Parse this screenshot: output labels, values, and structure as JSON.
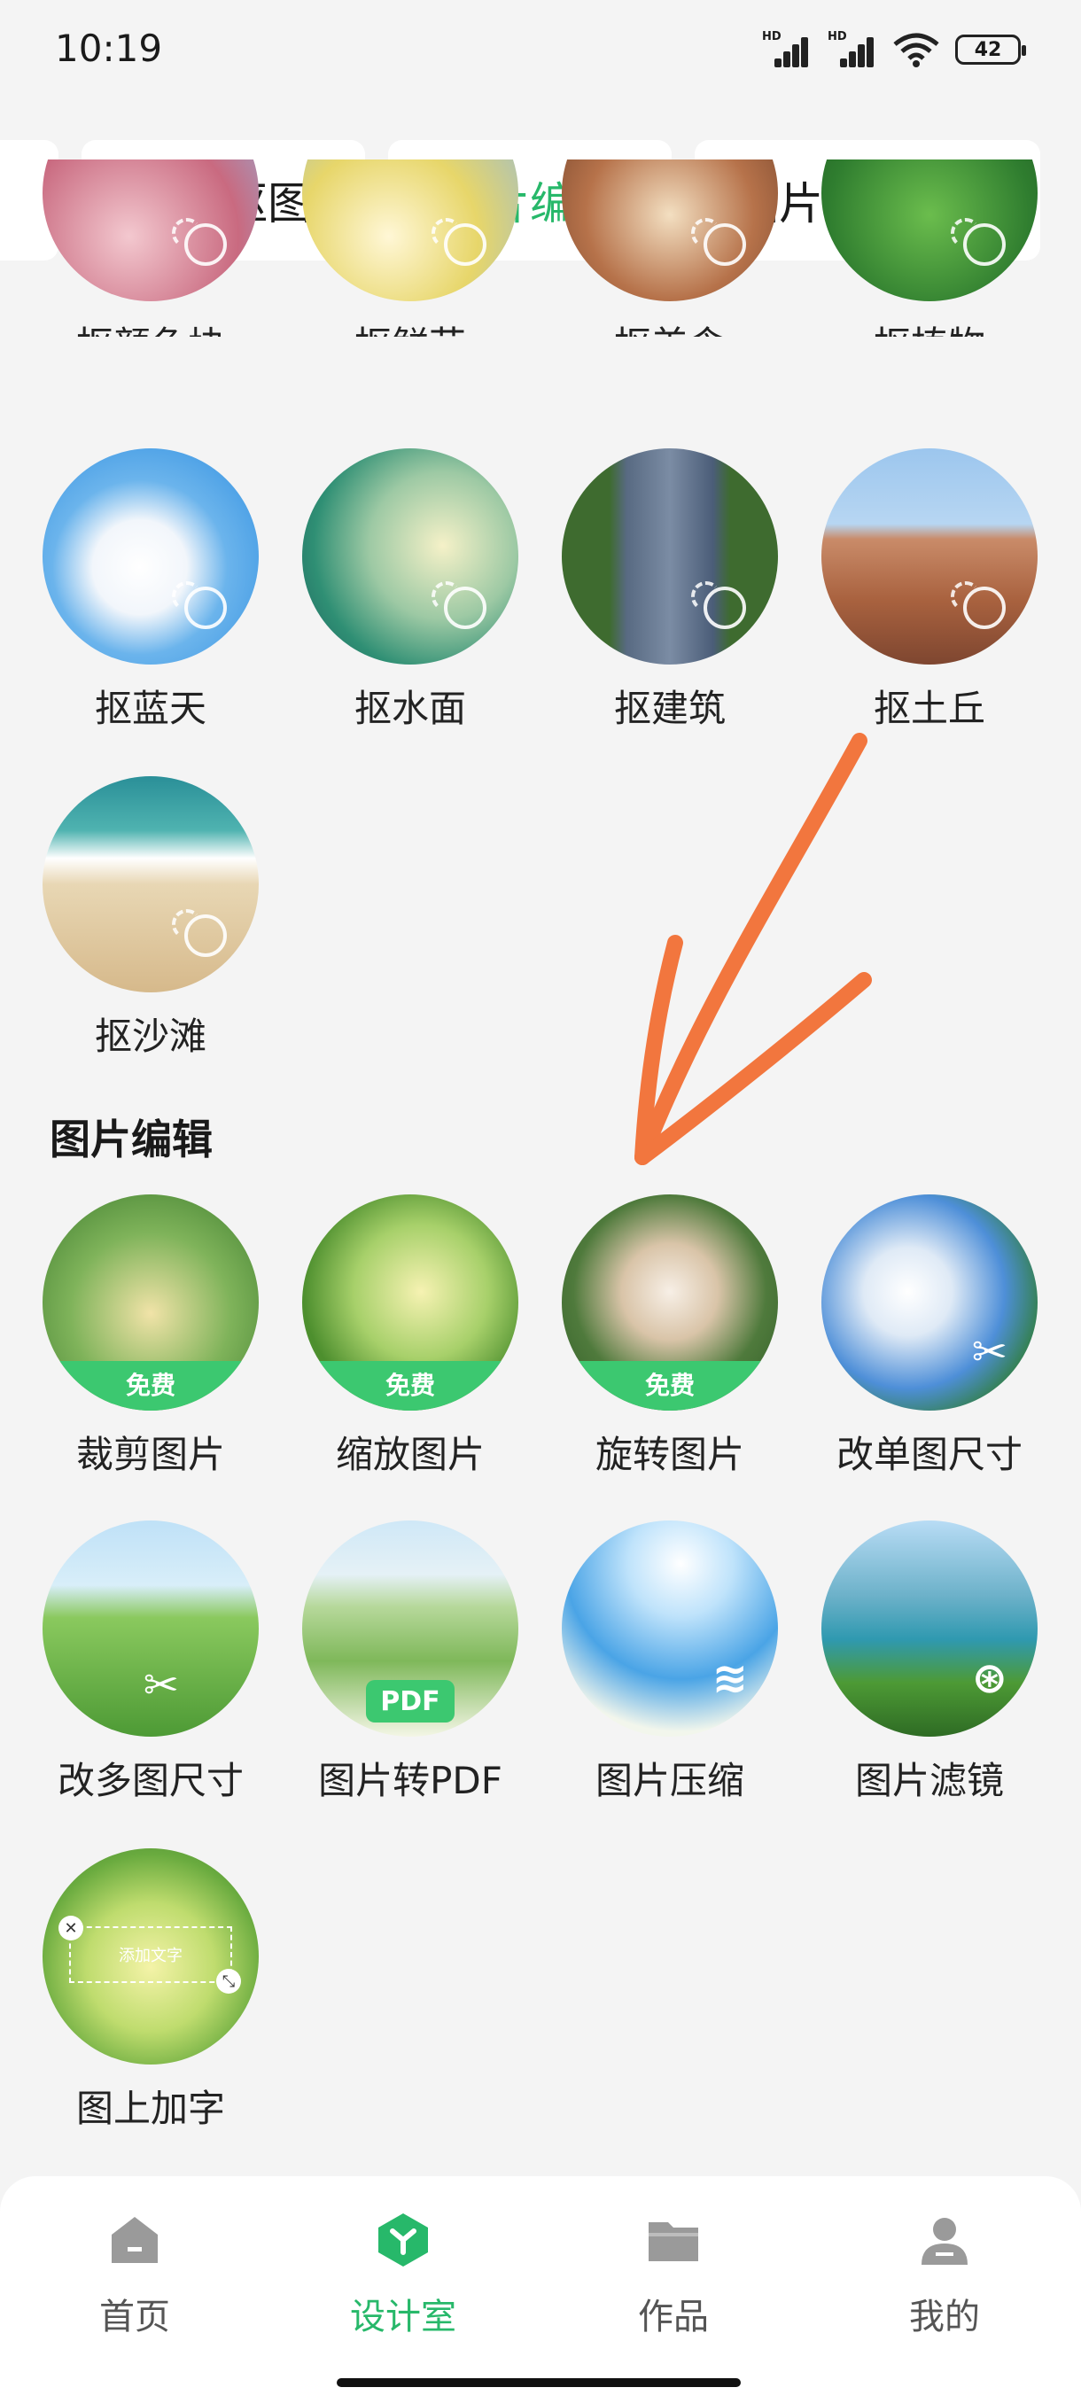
{
  "status": {
    "time": "10:19",
    "hd1": "HD",
    "hd2": "HD",
    "battery": "42"
  },
  "tabs": [
    {
      "label": "一键抠图"
    },
    {
      "label": "图片编辑",
      "active": true
    },
    {
      "label": "图片格式转换"
    }
  ],
  "top_row": [
    "抠颜色块",
    "抠鲜花",
    "抠美食",
    "抠植物"
  ],
  "row2": [
    "抠蓝天",
    "抠水面",
    "抠建筑",
    "抠土丘"
  ],
  "row3": [
    "抠沙滩"
  ],
  "section": {
    "title": "图片编辑"
  },
  "edit_row1": [
    {
      "label": "裁剪图片",
      "badge": "免费"
    },
    {
      "label": "缩放图片",
      "badge": "免费"
    },
    {
      "label": "旋转图片",
      "badge": "免费"
    },
    {
      "label": "改单图尺寸"
    }
  ],
  "edit_row2": [
    {
      "label": "改多图尺寸"
    },
    {
      "label": "图片转PDF",
      "badge": "PDF"
    },
    {
      "label": "图片压缩"
    },
    {
      "label": "图片滤镜"
    }
  ],
  "edit_row3": [
    {
      "label": "图上加字",
      "box_text": "添加文字"
    }
  ],
  "nav": [
    {
      "label": "首页",
      "icon": "home-icon"
    },
    {
      "label": "设计室",
      "icon": "design-icon",
      "active": true
    },
    {
      "label": "作品",
      "icon": "folder-icon"
    },
    {
      "label": "我的",
      "icon": "profile-icon"
    }
  ],
  "colors": {
    "accent": "#27b86a",
    "badge": "#3cc870",
    "arrow": "#f2763e"
  }
}
